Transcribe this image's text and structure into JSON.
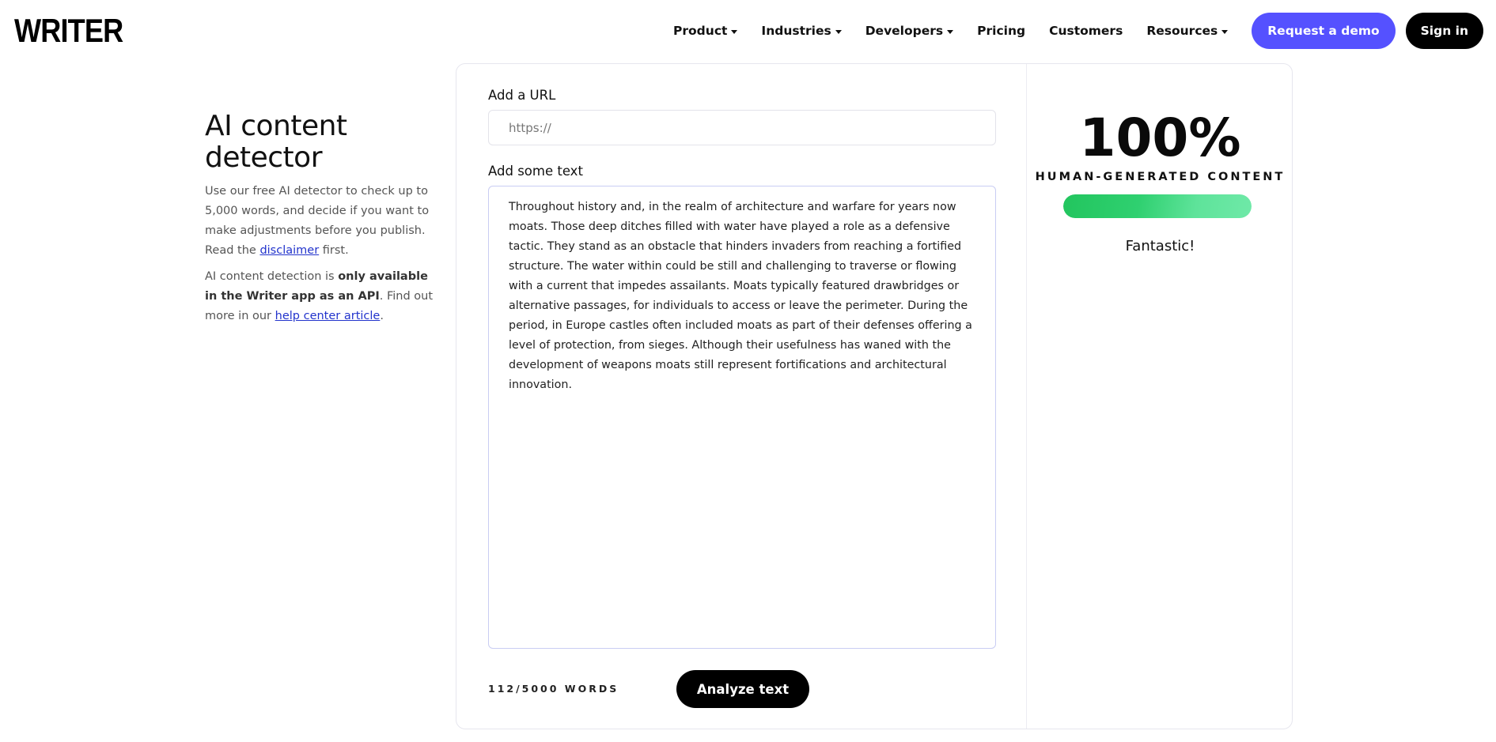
{
  "header": {
    "logo": "WRITER",
    "nav": [
      {
        "label": "Product",
        "dropdown": true
      },
      {
        "label": "Industries",
        "dropdown": true
      },
      {
        "label": "Developers",
        "dropdown": true
      },
      {
        "label": "Pricing",
        "dropdown": false
      },
      {
        "label": "Customers",
        "dropdown": false
      },
      {
        "label": "Resources",
        "dropdown": true
      }
    ],
    "demo_button": "Request a demo",
    "signin_button": "Sign in",
    "accent_color": "#5551ff"
  },
  "intro": {
    "title": "AI content detector",
    "p1_text_1": "Use our free AI detector to check up to 5,000 words, and decide if you want to make adjustments before you publish. Read the ",
    "p1_link": "disclaimer",
    "p1_text_2": " first.",
    "p2_text_1": "AI content detection is ",
    "p2_strong": "only available in the Writer app as an API",
    "p2_text_2": ". Find out more in our ",
    "p2_link": "help center article",
    "p2_text_3": "."
  },
  "form": {
    "url_label": "Add a URL",
    "url_placeholder": "https://",
    "url_value": "",
    "text_label": "Add some text",
    "text_value": "Throughout history and, in the realm of architecture and warfare for years now moats. Those deep ditches filled with water have played a role as a defensive tactic. They stand as an obstacle that hinders invaders from reaching a fortified structure. The water within could be still and challenging to traverse or flowing with a current that impedes assailants. Moats typically featured drawbridges or alternative passages, for individuals to access or leave the perimeter. During the period, in Europe castles often included moats as part of their defenses offering a level of protection, from sieges. Although their usefulness has waned with the development of weapons moats still represent fortifications and architectural innovation.",
    "word_count": "112/5000 WORDS",
    "analyze_button": "Analyze text"
  },
  "result": {
    "percent": "100%",
    "label": "HUMAN-GENERATED CONTENT",
    "score_fraction": 1.0,
    "verdict": "Fantastic!",
    "bar_color": "#22c55e"
  }
}
